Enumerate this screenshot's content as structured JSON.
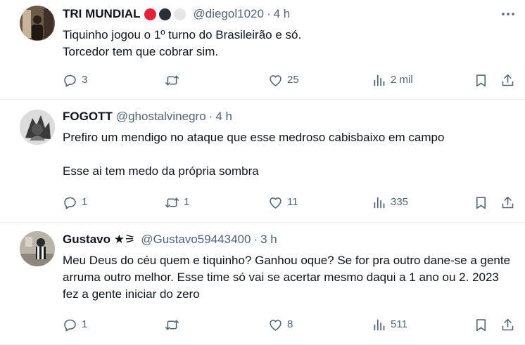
{
  "tweets": [
    {
      "name": "TRI MUNDIAL",
      "badges": [
        "#e0223a",
        "#2a2f36",
        "#e6e6e6"
      ],
      "handle": "@diegol1020",
      "dot": "·",
      "time": "4 h",
      "text": "Tiquinho jogou o 1º turno do Brasileirão e só.\nTorcedor tem que cobrar sim.",
      "replies": "3",
      "retweets": "",
      "likes": "25",
      "views": "2 mil"
    },
    {
      "name": "FOGOTT",
      "handle": "@ghostalvinegro",
      "dot": "·",
      "time": "4 h",
      "text": "Prefiro um mendigo no ataque que esse medroso cabisbaixo em campo\n\nEsse ai tem medo da própria sombra",
      "replies": "1",
      "retweets": "1",
      "likes": "11",
      "views": "335"
    },
    {
      "name": "Gustavo ★⚞",
      "handle": "@Gustavo59443400",
      "dot": "·",
      "time": "3 h",
      "text": "Meu Deus do céu quem e tiquinho? Ganhou oque? Se for pra outro dane-se a gente arruma outro melhor. Esse time só vai se acertar mesmo daqui a 1 ano ou 2. 2023 fez a gente iniciar do zero",
      "replies": "1",
      "retweets": "",
      "likes": "8",
      "views": "511"
    }
  ],
  "icons": {
    "reply": "reply-icon",
    "retweet": "retweet-icon",
    "like": "heart-icon",
    "views": "views-icon",
    "bookmark": "bookmark-icon",
    "share": "share-icon",
    "more": "more-icon"
  },
  "colors": {
    "text": "#0f1419",
    "muted": "#536471",
    "divider": "#eff3f4"
  }
}
